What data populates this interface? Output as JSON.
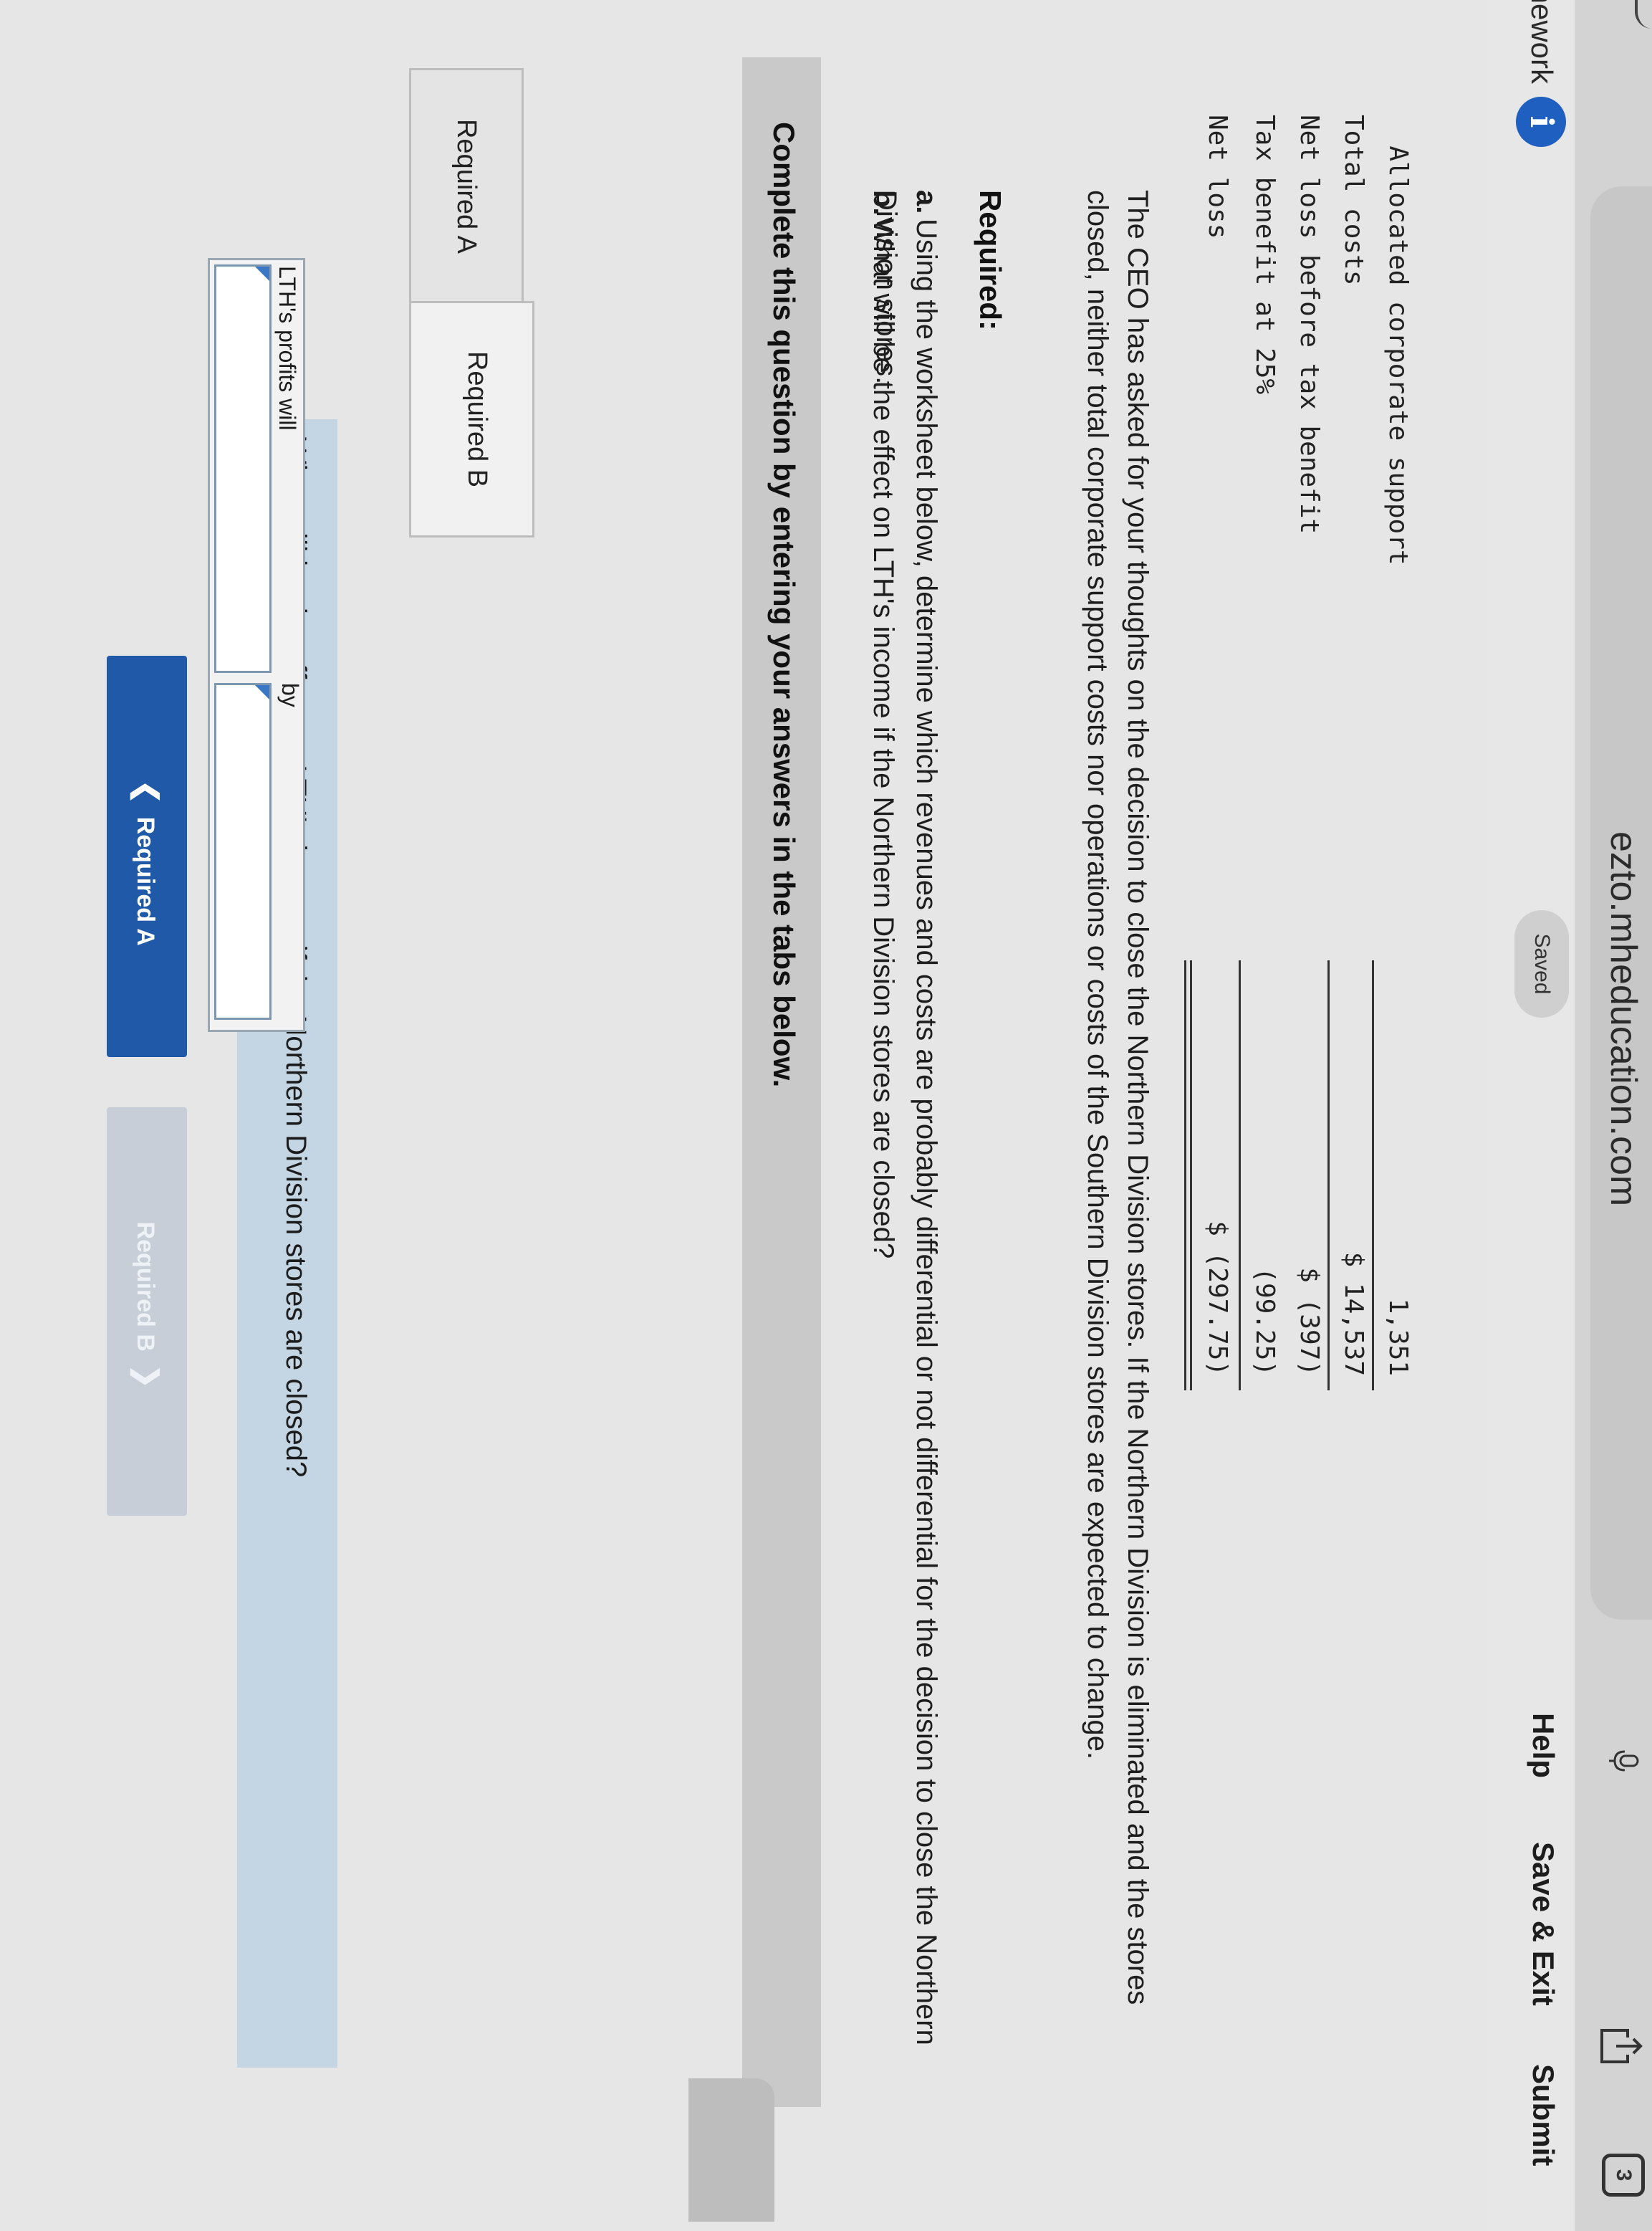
{
  "browser": {
    "url": "ezto.mheducation.com",
    "tab_count": "3"
  },
  "header": {
    "homework_label": "mework",
    "info_symbol": "i",
    "saved_label": "Saved",
    "help_label": "Help",
    "save_exit_label": "Save & Exit",
    "submit_label": "Submit"
  },
  "financials": {
    "rows": [
      {
        "label": "  Allocated corporate support",
        "value": "1,351"
      },
      {
        "label": "Total costs",
        "value": "$ 14,537"
      },
      {
        "label": "Net loss before tax benefit",
        "value": "$ (397)"
      },
      {
        "label": "Tax benefit at 25%",
        "value": "(99.25)"
      },
      {
        "label": "Net loss",
        "value": "$ (297.75)"
      }
    ]
  },
  "body": {
    "paragraph": "The CEO has asked for your thoughts on the decision to close the Northern Division stores. If the Northern Division is eliminated and the stores closed, neither total corporate support costs nor operations or costs of the Southern Division stores are expected to change.",
    "required_title": "Required:",
    "items": [
      {
        "letter": "a.",
        "text": "Using the worksheet below, determine which revenues and costs are probably differential or not differential for the decision to close the Northern Division stores."
      },
      {
        "letter": "b.",
        "text": "What will be the effect on LTH's income if the Northern Division stores are closed?"
      }
    ]
  },
  "question_panel": {
    "instructions": "Complete this question by entering your answers in the tabs below.",
    "tabs": [
      {
        "label": "Required A"
      },
      {
        "label": "Required B"
      }
    ],
    "question": "What will be the effect on LTH's income if the Northern Division stores are closed?",
    "answer_label": "LTH's profits will",
    "answer_value": "",
    "by_label": "by",
    "amount_value": ""
  },
  "navigation": {
    "prev_label": "Required A",
    "next_label": "Required B"
  }
}
